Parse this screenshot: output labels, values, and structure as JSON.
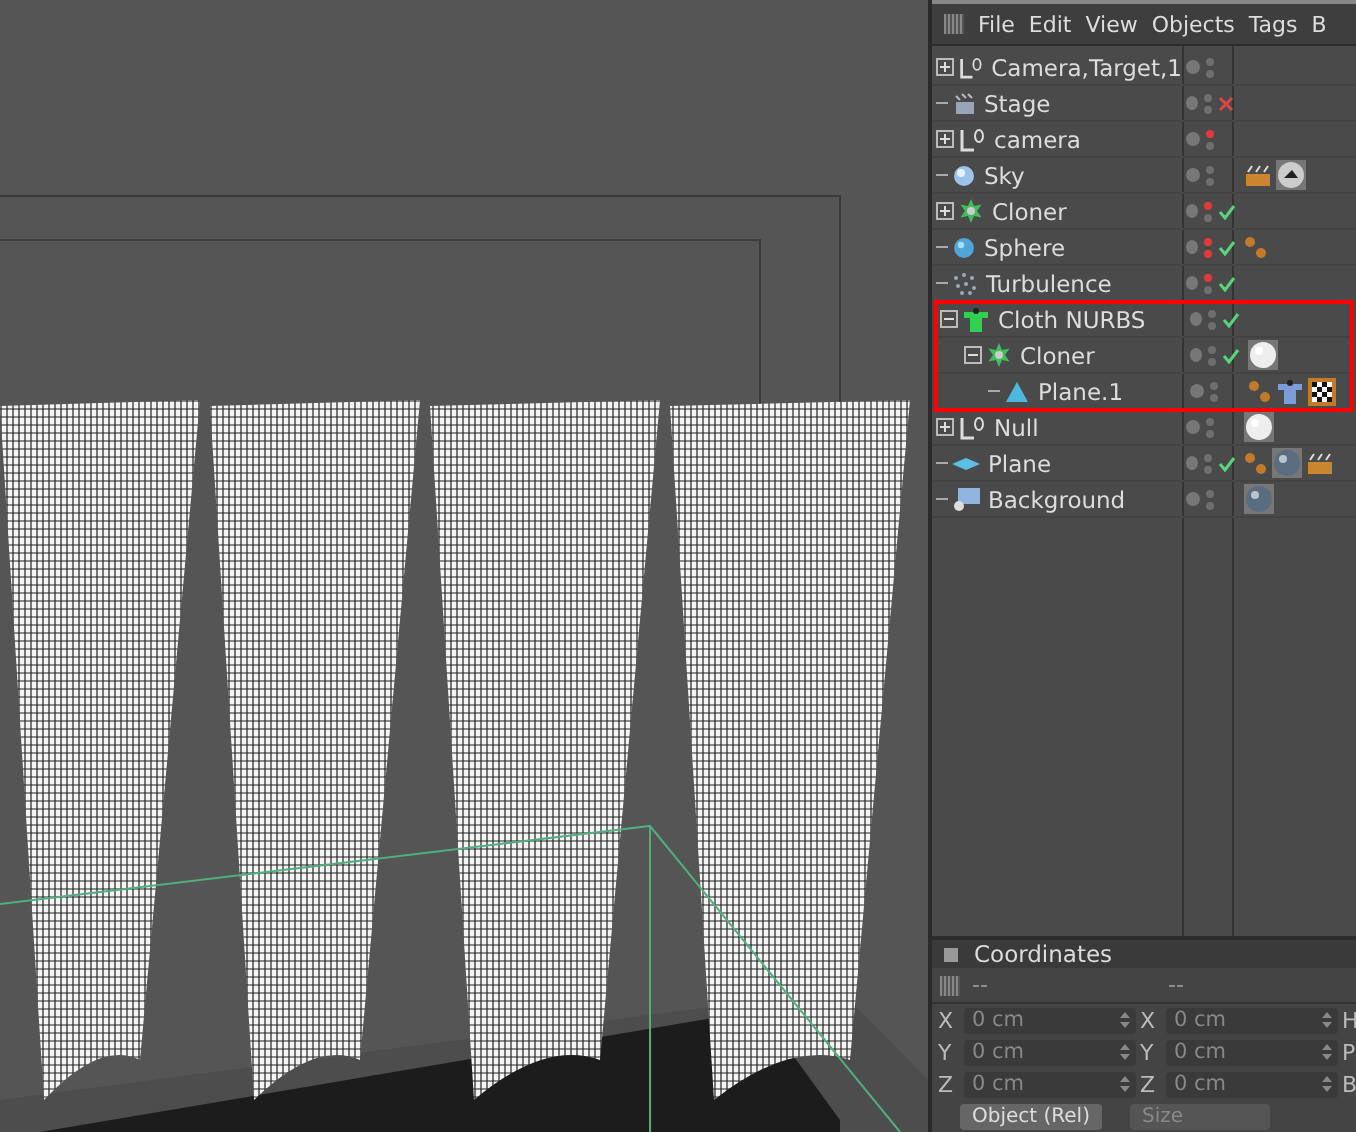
{
  "viewport": {
    "kind": "wireframe"
  },
  "object_manager": {
    "menu": [
      "File",
      "Edit",
      "View",
      "Objects",
      "Tags",
      "B"
    ],
    "objects": [
      {
        "name": "Camera,Target,1",
        "kind": "axis",
        "expanded": false,
        "editor_flag": false,
        "render_flag": false
      },
      {
        "name": "Stage",
        "kind": "stage",
        "editor_flag": false,
        "render_flag": false,
        "enabled": false
      },
      {
        "name": "camera",
        "kind": "axis",
        "expanded": false,
        "editor_flag": true,
        "render_flag": false
      },
      {
        "name": "Sky",
        "kind": "sphere",
        "editor_flag": false,
        "render_flag": false,
        "tags": [
          {
            "kind": "clapper"
          },
          {
            "kind": "sky-material"
          }
        ]
      },
      {
        "name": "Cloner",
        "kind": "cloner",
        "expanded": false,
        "editor_flag": true,
        "render_flag": false,
        "enabled": true
      },
      {
        "name": "Sphere",
        "kind": "ball",
        "editor_flag": true,
        "render_flag": true,
        "enabled": true,
        "tags": [
          {
            "kind": "phong"
          }
        ]
      },
      {
        "name": "Turbulence",
        "kind": "turbulence",
        "editor_flag": true,
        "render_flag": false,
        "enabled": true
      },
      {
        "name": "Cloth NURBS",
        "kind": "cloth",
        "expanded": true,
        "highlighted": true,
        "editor_flag": false,
        "render_flag": false,
        "enabled": true,
        "children": [
          {
            "name": "Cloner",
            "kind": "cloner",
            "expanded": true,
            "editor_flag": false,
            "render_flag": false,
            "enabled": true,
            "tags": [
              {
                "kind": "white-material"
              }
            ],
            "children": [
              {
                "name": "Plane.1",
                "kind": "cone",
                "editor_flag": false,
                "render_flag": false,
                "tags": [
                  {
                    "kind": "phong"
                  },
                  {
                    "kind": "cloth"
                  },
                  {
                    "kind": "checker"
                  }
                ]
              }
            ]
          }
        ]
      },
      {
        "name": "Null",
        "kind": "axis",
        "expanded": false,
        "editor_flag": false,
        "render_flag": false,
        "tags": [
          {
            "kind": "white-material"
          }
        ]
      },
      {
        "name": "Plane",
        "kind": "plane",
        "editor_flag": false,
        "render_flag": false,
        "enabled": true,
        "tags": [
          {
            "kind": "phong"
          },
          {
            "kind": "grey-material"
          },
          {
            "kind": "clapper"
          }
        ]
      },
      {
        "name": "Background",
        "kind": "background",
        "editor_flag": false,
        "render_flag": false,
        "tags": [
          {
            "kind": "grey-material"
          }
        ]
      }
    ]
  },
  "coordinates": {
    "title": "Coordinates",
    "headers": [
      "--",
      "--"
    ],
    "rows": [
      {
        "axis": "X",
        "position": "0 cm",
        "axis2": "X",
        "size": "0 cm",
        "rotation_label": "H"
      },
      {
        "axis": "Y",
        "position": "0 cm",
        "axis2": "Y",
        "size": "0 cm",
        "rotation_label": "P"
      },
      {
        "axis": "Z",
        "position": "0 cm",
        "axis2": "Z",
        "size": "0 cm",
        "rotation_label": "B"
      }
    ],
    "mode_dropdown": "Object (Rel)",
    "size_dropdown": "Size"
  }
}
